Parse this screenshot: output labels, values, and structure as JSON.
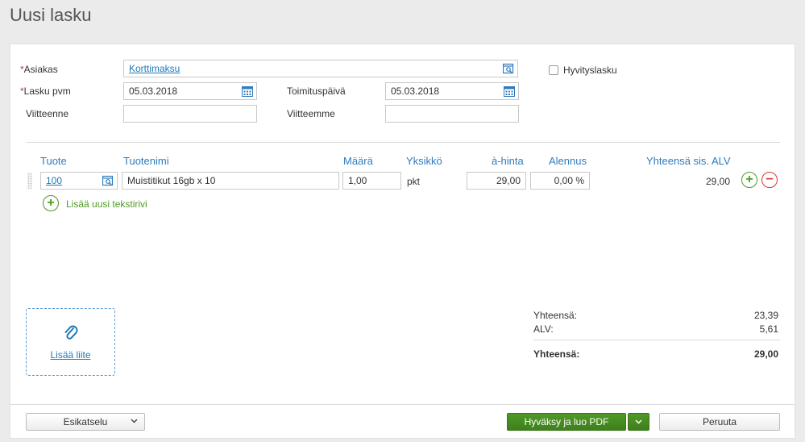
{
  "page": {
    "title": "Uusi lasku"
  },
  "form": {
    "customer_label": "Asiakas",
    "customer_value": "Korttimaksu",
    "invoice_date_label": "Lasku pvm",
    "invoice_date_value": "05.03.2018",
    "delivery_date_label": "Toimituspäivä",
    "delivery_date_value": "05.03.2018",
    "your_ref_label": "Viitteenne",
    "your_ref_value": "",
    "our_ref_label": "Viitteemme",
    "our_ref_value": "",
    "credit_note_label": "Hyvityslasku",
    "required_mark": "*"
  },
  "table": {
    "headers": {
      "product": "Tuote",
      "product_name": "Tuotenimi",
      "quantity": "Määrä",
      "unit": "Yksikkö",
      "unit_price": "à-hinta",
      "discount": "Alennus",
      "total_incl_vat": "Yhteensä sis. ALV"
    },
    "rows": [
      {
        "product": "100",
        "product_name": "Muistitikut 16gb x 10",
        "quantity": "1,00",
        "unit": "pkt",
        "unit_price": "29,00",
        "discount": "0,00 %",
        "total": "29,00"
      }
    ],
    "add_text_row_label": "Lisää uusi tekstirivi"
  },
  "attachment": {
    "label": "Lisää liite"
  },
  "totals": {
    "subtotal_label": "Yhteensä:",
    "subtotal_value": "23,39",
    "vat_label": "ALV:",
    "vat_value": "5,61",
    "grand_total_label": "Yhteensä:",
    "grand_total_value": "29,00"
  },
  "footer": {
    "preview_label": "Esikatselu",
    "approve_label": "Hyväksy ja luo PDF",
    "cancel_label": "Peruuta"
  },
  "colors": {
    "accent_blue": "#2f7bbd",
    "link_blue": "#1d7ab8",
    "green": "#4e9a24",
    "red": "#d9363e"
  }
}
